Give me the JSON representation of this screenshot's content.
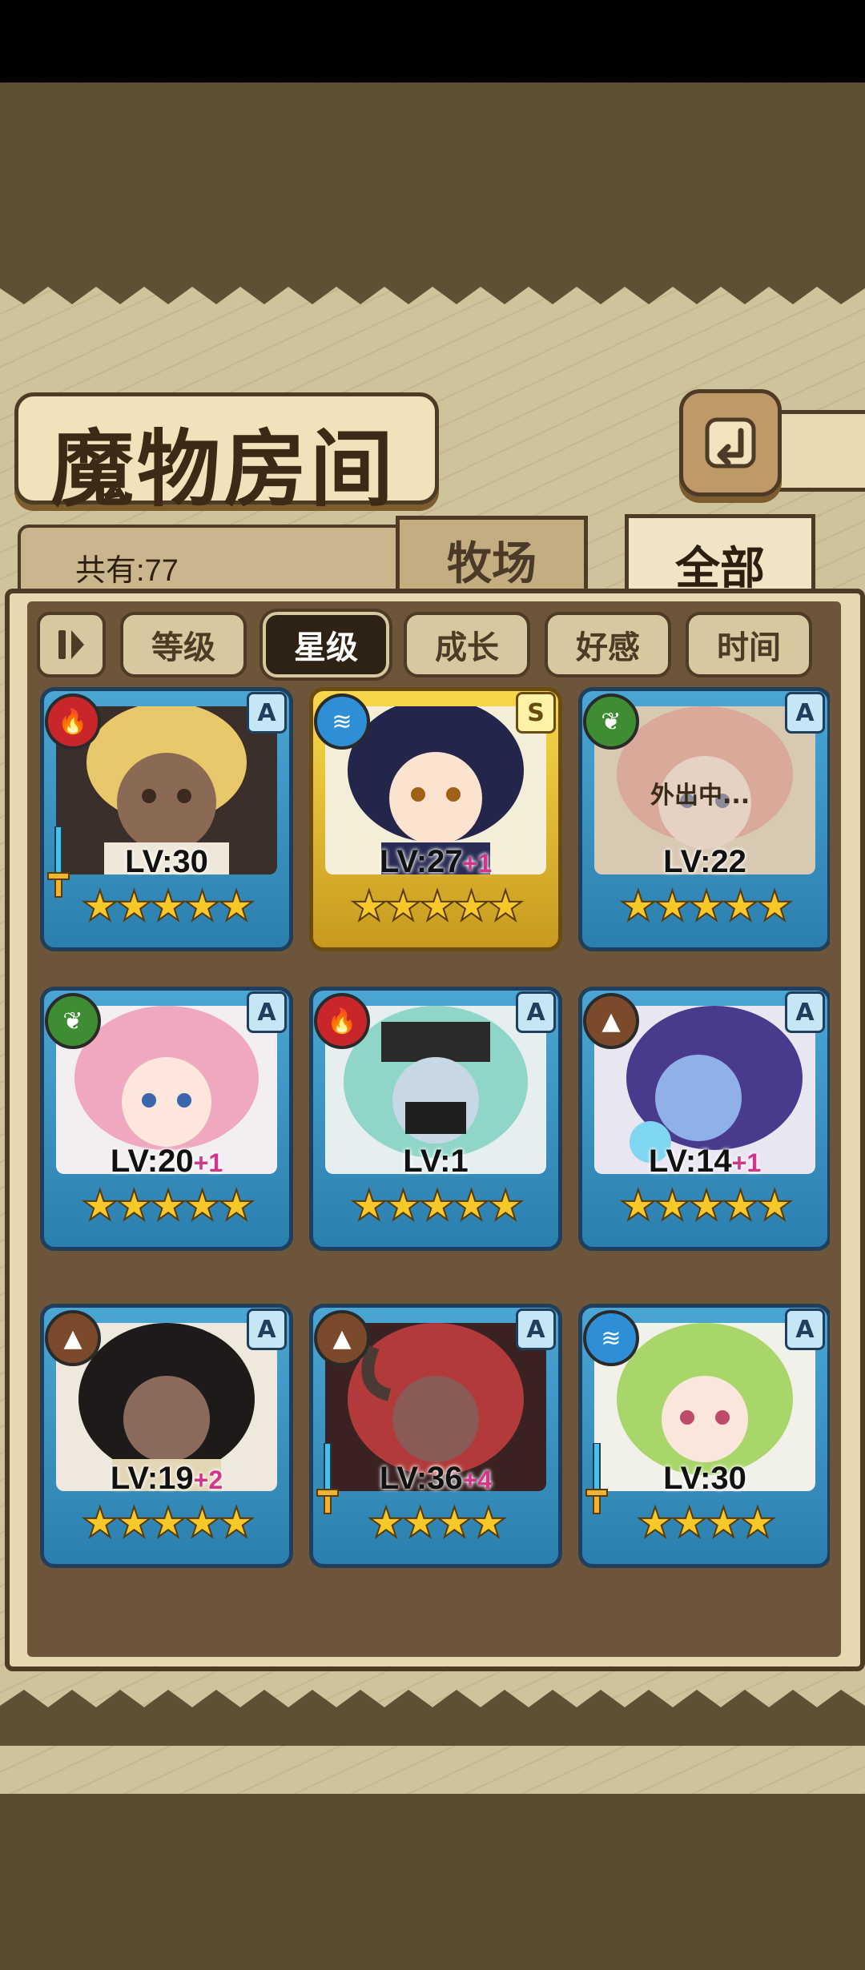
{
  "screen": {
    "title": "魔物房间"
  },
  "header": {
    "back_icon": "back-arrow-icon",
    "count_label": "共有:77"
  },
  "tabs": [
    {
      "label": "牧场",
      "active": false
    },
    {
      "label": "全部",
      "active": true
    }
  ],
  "sort": {
    "buttons": [
      {
        "label": "等级",
        "active": false
      },
      {
        "label": "星级",
        "active": true
      },
      {
        "label": "成长",
        "active": false
      },
      {
        "label": "好感",
        "active": false
      },
      {
        "label": "时间",
        "active": false
      }
    ]
  },
  "cards": [
    {
      "element": "fire",
      "rank": "A",
      "level": "LV:30",
      "bonus": "",
      "stars": "★★★★★",
      "frame": "blue",
      "status": ""
    },
    {
      "element": "water",
      "rank": "S",
      "level": "LV:27",
      "bonus": "+1",
      "stars": "★★★★★",
      "frame": "gold",
      "status": ""
    },
    {
      "element": "wood",
      "rank": "A",
      "level": "LV:22",
      "bonus": "",
      "stars": "★★★★★",
      "frame": "blue",
      "status": "外出中..."
    },
    {
      "element": "wood",
      "rank": "A",
      "level": "LV:20",
      "bonus": "+1",
      "stars": "★★★★★",
      "frame": "blue",
      "status": ""
    },
    {
      "element": "fire",
      "rank": "A",
      "level": "LV:1",
      "bonus": "",
      "stars": "★★★★★",
      "frame": "blue",
      "status": ""
    },
    {
      "element": "earth",
      "rank": "A",
      "level": "LV:14",
      "bonus": "+1",
      "stars": "★★★★★",
      "frame": "blue",
      "status": ""
    },
    {
      "element": "earth",
      "rank": "A",
      "level": "LV:19",
      "bonus": "+2",
      "stars": "★★★★★",
      "frame": "blue",
      "status": ""
    },
    {
      "element": "earth",
      "rank": "A",
      "level": "LV:36",
      "bonus": "+4",
      "stars": "★★★★",
      "frame": "blue",
      "status": ""
    },
    {
      "element": "water",
      "rank": "A",
      "level": "LV:30",
      "bonus": "",
      "stars": "★★★★",
      "frame": "blue",
      "status": ""
    }
  ],
  "colors": {
    "fire": "#c8262a",
    "water": "#2f8fd6",
    "wood": "#3f8d33",
    "earth": "#7a4a2a",
    "frame_blue": "#3a96c8",
    "frame_gold": "#e8c236",
    "bonus": "#d2358b"
  }
}
